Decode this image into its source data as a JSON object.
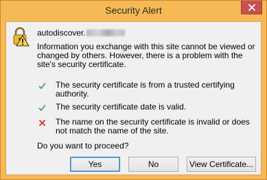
{
  "window": {
    "title": "Security Alert"
  },
  "site": {
    "prefix": "autodiscover."
  },
  "intro": "Information you exchange with this site cannot be viewed or changed by others. However, there is a problem with the site's security certificate.",
  "checks": [
    {
      "status": "pass",
      "icon": "green-check-icon",
      "text": "The security certificate is from a trusted certifying authority."
    },
    {
      "status": "pass",
      "icon": "green-check-icon",
      "text": "The security certificate date is valid."
    },
    {
      "status": "fail",
      "icon": "red-x-icon",
      "text": "The name on the security certificate is invalid or does not match the name of the site."
    }
  ],
  "question": "Do you want to proceed?",
  "buttons": {
    "yes": "Yes",
    "no": "No",
    "view": "View Certificate..."
  },
  "colors": {
    "title_bar": "#f7b955",
    "close_button": "#c75050",
    "client_bg": "#f0f0f0",
    "pass": "#4a9a74",
    "fail": "#d9403a"
  }
}
